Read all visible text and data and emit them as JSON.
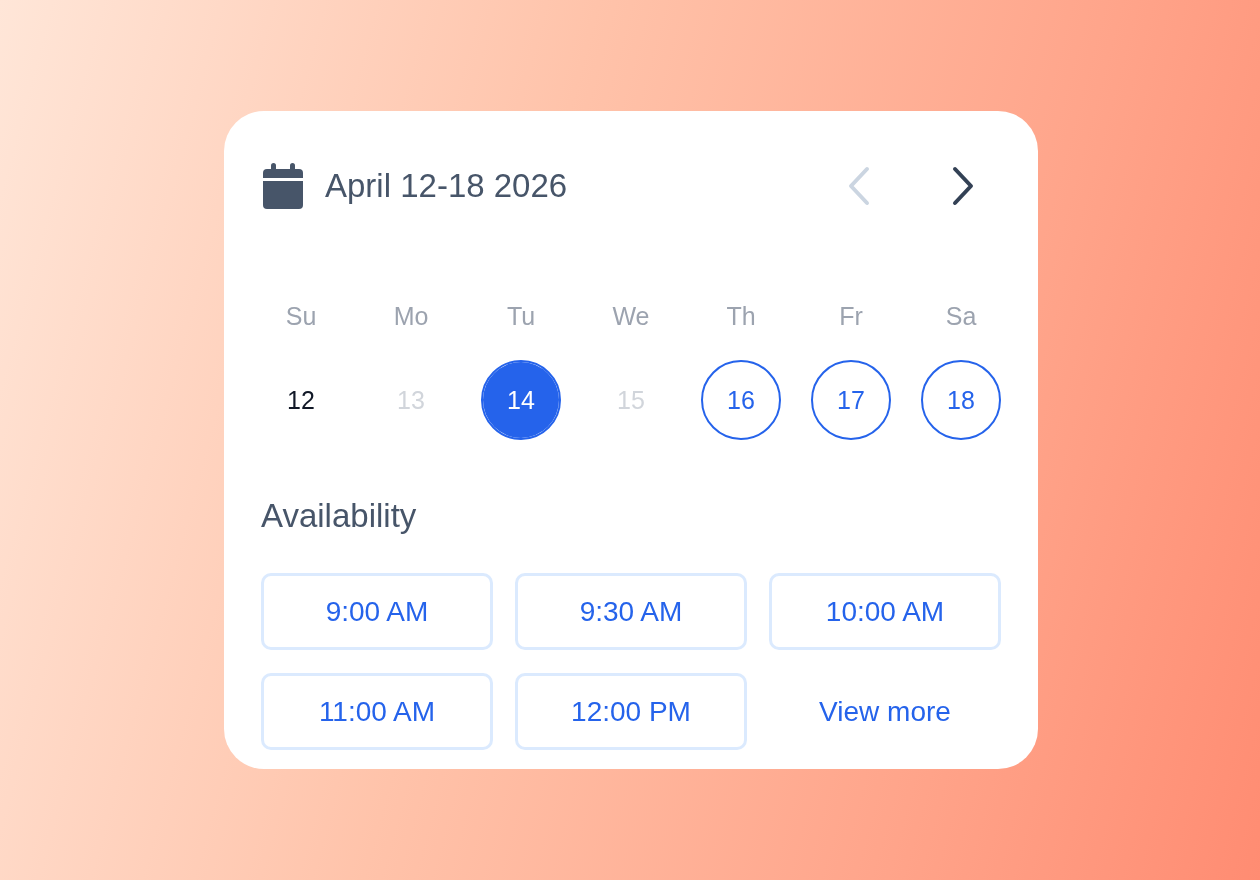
{
  "header": {
    "title": "April 12-18 2026",
    "nav": [
      {
        "kind": "prev",
        "disabled": true
      },
      {
        "kind": "next",
        "disabled": false
      }
    ]
  },
  "weekdays": [
    "Su",
    "Mo",
    "Tu",
    "We",
    "Th",
    "Fr",
    "Sa"
  ],
  "days": [
    {
      "label": "12",
      "selected": false,
      "disabled": false,
      "available": false
    },
    {
      "label": "13",
      "selected": false,
      "disabled": true,
      "available": false
    },
    {
      "label": "14",
      "selected": true,
      "disabled": false,
      "available": true
    },
    {
      "label": "15",
      "selected": false,
      "disabled": true,
      "available": false
    },
    {
      "label": "16",
      "selected": false,
      "disabled": false,
      "available": true
    },
    {
      "label": "17",
      "selected": false,
      "disabled": false,
      "available": true
    },
    {
      "label": "18",
      "selected": false,
      "disabled": false,
      "available": true
    }
  ],
  "availability": {
    "title": "Availability",
    "slots": [
      {
        "kind": "slot",
        "label": "9:00 AM"
      },
      {
        "kind": "slot",
        "label": "9:30 AM"
      },
      {
        "kind": "slot",
        "label": "10:00 AM"
      },
      {
        "kind": "slot",
        "label": "11:00 AM"
      },
      {
        "kind": "slot",
        "label": "12:00 PM"
      },
      {
        "kind": "link",
        "label": "View more"
      }
    ]
  }
}
